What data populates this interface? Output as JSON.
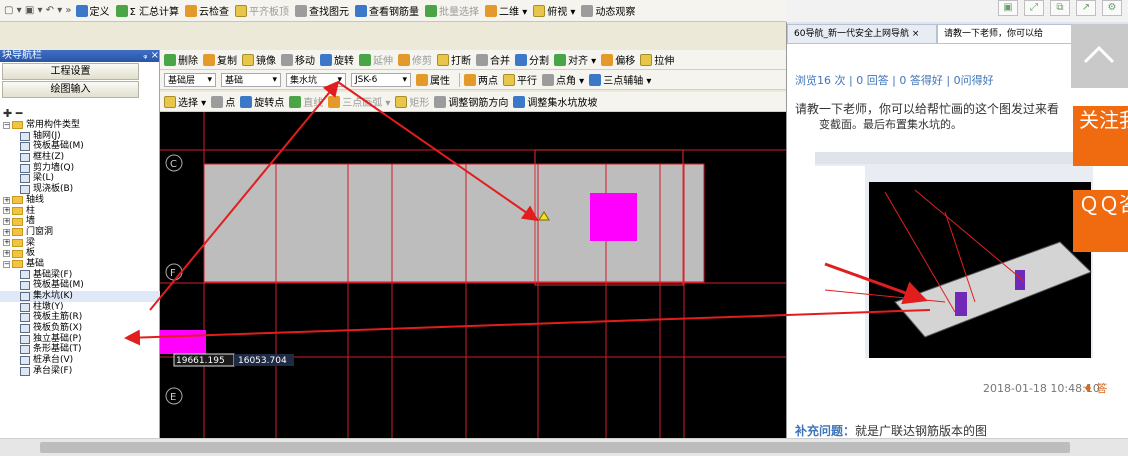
{
  "menubar": {
    "items": [
      {
        "label": "定义",
        "icon": "definition-icon"
      },
      {
        "label": "Σ 汇总计算",
        "icon": "summary-calc-icon"
      },
      {
        "label": "云检查",
        "icon": "cloud-check-icon"
      },
      {
        "label": "平齐板顶",
        "icon": "align-top-icon",
        "disabled": true
      },
      {
        "label": "查找图元",
        "icon": "find-element-icon"
      },
      {
        "label": "查看钢筋量",
        "icon": "view-rebar-icon"
      },
      {
        "label": "批量选择",
        "icon": "batch-select-icon",
        "disabled": true
      },
      {
        "label": "二维 ▾",
        "icon": "2d-view-icon"
      },
      {
        "label": "俯视 ▾",
        "icon": "top-view-icon"
      },
      {
        "label": "动态观察",
        "icon": "orbit-icon"
      }
    ]
  },
  "nav_panel": {
    "title": "块导航栏",
    "pin": "ᵩ ×",
    "buttons": [
      "工程设置",
      "绘图输入"
    ],
    "tree": [
      {
        "label": "常用构件类型",
        "level": 0,
        "folder": true,
        "toggle": "−"
      },
      {
        "label": "轴网(J)",
        "level": 1
      },
      {
        "label": "筏板基础(M)",
        "level": 1
      },
      {
        "label": "框柱(Z)",
        "level": 1
      },
      {
        "label": "剪力墙(Q)",
        "level": 1
      },
      {
        "label": "梁(L)",
        "level": 1
      },
      {
        "label": "现浇板(B)",
        "level": 1
      },
      {
        "label": "轴线",
        "level": 0,
        "folder": true,
        "toggle": "+"
      },
      {
        "label": "柱",
        "level": 0,
        "folder": true,
        "toggle": "+"
      },
      {
        "label": "墙",
        "level": 0,
        "folder": true,
        "toggle": "+"
      },
      {
        "label": "门窗洞",
        "level": 0,
        "folder": true,
        "toggle": "+"
      },
      {
        "label": "梁",
        "level": 0,
        "folder": true,
        "toggle": "+"
      },
      {
        "label": "板",
        "level": 0,
        "folder": true,
        "toggle": "+"
      },
      {
        "label": "基础",
        "level": 0,
        "folder": true,
        "toggle": "−"
      },
      {
        "label": "基础梁(F)",
        "level": 1
      },
      {
        "label": "筏板基础(M)",
        "level": 1
      },
      {
        "label": "集水坑(K)",
        "level": 1,
        "selected": true
      },
      {
        "label": "柱墩(Y)",
        "level": 1
      },
      {
        "label": "筏板主筋(R)",
        "level": 1
      },
      {
        "label": "筏板负筋(X)",
        "level": 1
      },
      {
        "label": "独立基础(P)",
        "level": 1
      },
      {
        "label": "条形基础(T)",
        "level": 1
      },
      {
        "label": "桩承台(V)",
        "level": 1
      },
      {
        "label": "承台梁(F)",
        "level": 1
      }
    ]
  },
  "toolbar1": {
    "items": [
      "删除",
      "复制",
      "镜像",
      "移动",
      "旋转",
      "延伸",
      "修剪",
      "打断",
      "合并",
      "分割",
      "对齐 ▾",
      "偏移",
      "拉伸"
    ]
  },
  "toolbar2": {
    "floor": "基础层",
    "category": "基础",
    "type": "集水坑",
    "name": "JSK-6",
    "property": "属性",
    "items": [
      "两点",
      "平行",
      "点角 ▾",
      "三点辅轴 ▾"
    ]
  },
  "toolbar3": {
    "items": [
      "选择 ▾",
      "点",
      "旋转点",
      "直线",
      "三点画弧 ▾",
      "矩形",
      "调整钢筋方向",
      "调整集水坑放坡"
    ]
  },
  "canvas": {
    "axis_labels": [
      "C",
      "F",
      "E"
    ],
    "coord_x": "19661.195",
    "coord_y": "16053.704"
  },
  "browser": {
    "tabs": [
      "60导航_新一代安全上网导航",
      "请教一下老师，你可以给"
    ],
    "tab_close": "×",
    "stats": "浏览16 次 | 0 回答 | 0 答得好 | 0问得好",
    "question_line1": "请教一下老师，你可以给帮忙画的这个图发过来看",
    "question_line2": "变截面。最后布置集水坑的。",
    "date": "2018-01-18 10:48:10",
    "answer_button": "答",
    "supplement_label": "补充问题：",
    "supplement_text": "就是广联达钢筋版本的图",
    "side_banner1": "关注我们",
    "side_banner2": "ＱＱ咨询"
  },
  "colors": {
    "accent": "#3f76b8",
    "orange": "#f06a0f",
    "magenta": "#ff00ff",
    "grid_red": "#d21b2b",
    "slab_gray": "#bdbdbd"
  }
}
